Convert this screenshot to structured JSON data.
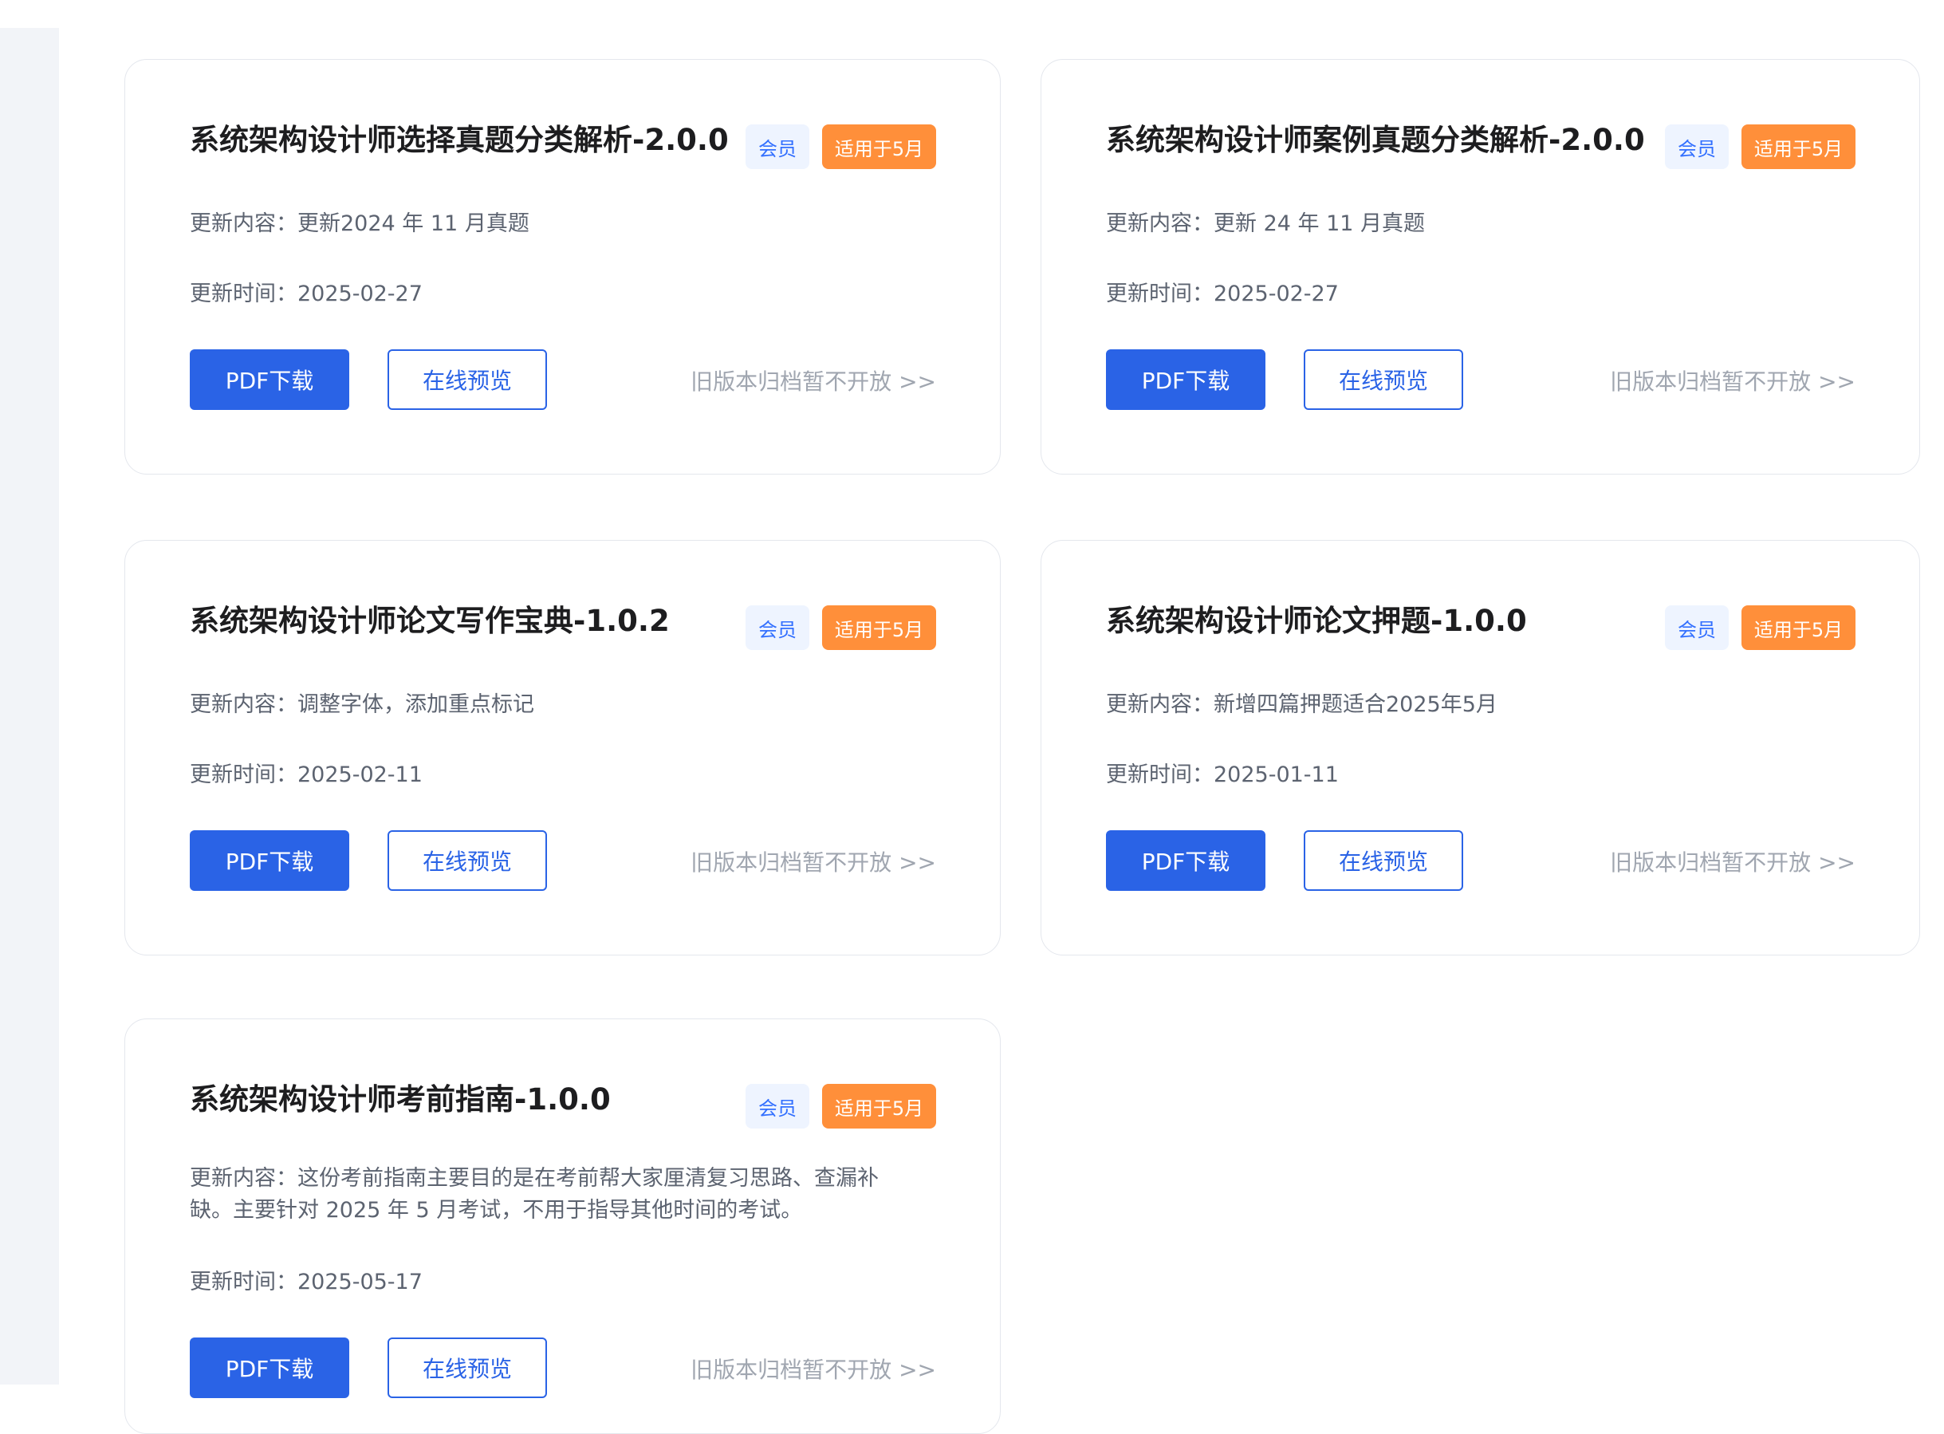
{
  "cards": [
    {
      "title": "系统架构设计师选择真题分类解析-2.0.0",
      "badge_member": "会员",
      "badge_month": "适用于5月",
      "content": "更新内容：更新2024 年 11 月真题",
      "time": "更新时间：2025-02-27",
      "pdf_label": "PDF下载",
      "preview_label": "在线预览",
      "archive_label": "旧版本归档暂不开放 >>"
    },
    {
      "title": "系统架构设计师案例真题分类解析-2.0.0",
      "badge_member": "会员",
      "badge_month": "适用于5月",
      "content": "更新内容：更新 24 年 11 月真题",
      "time": "更新时间：2025-02-27",
      "pdf_label": "PDF下载",
      "preview_label": "在线预览",
      "archive_label": "旧版本归档暂不开放 >>"
    },
    {
      "title": "系统架构设计师论文写作宝典-1.0.2",
      "badge_member": "会员",
      "badge_month": "适用于5月",
      "content": "更新内容：调整字体，添加重点标记",
      "time": "更新时间：2025-02-11",
      "pdf_label": "PDF下载",
      "preview_label": "在线预览",
      "archive_label": "旧版本归档暂不开放 >>"
    },
    {
      "title": "系统架构设计师论文押题-1.0.0",
      "badge_member": "会员",
      "badge_month": "适用于5月",
      "content": "更新内容：新增四篇押题适合2025年5月",
      "time": "更新时间：2025-01-11",
      "pdf_label": "PDF下载",
      "preview_label": "在线预览",
      "archive_label": "旧版本归档暂不开放 >>"
    },
    {
      "title": "系统架构设计师考前指南-1.0.0",
      "badge_member": "会员",
      "badge_month": "适用于5月",
      "content": "更新内容：这份考前指南主要目的是在考前帮大家厘清复习思路、查漏补缺。主要针对 2025 年 5 月考试，不用于指导其他时间的考试。",
      "time": "更新时间：2025-05-17",
      "pdf_label": "PDF下载",
      "preview_label": "在线预览",
      "archive_label": "旧版本归档暂不开放 >>"
    }
  ]
}
